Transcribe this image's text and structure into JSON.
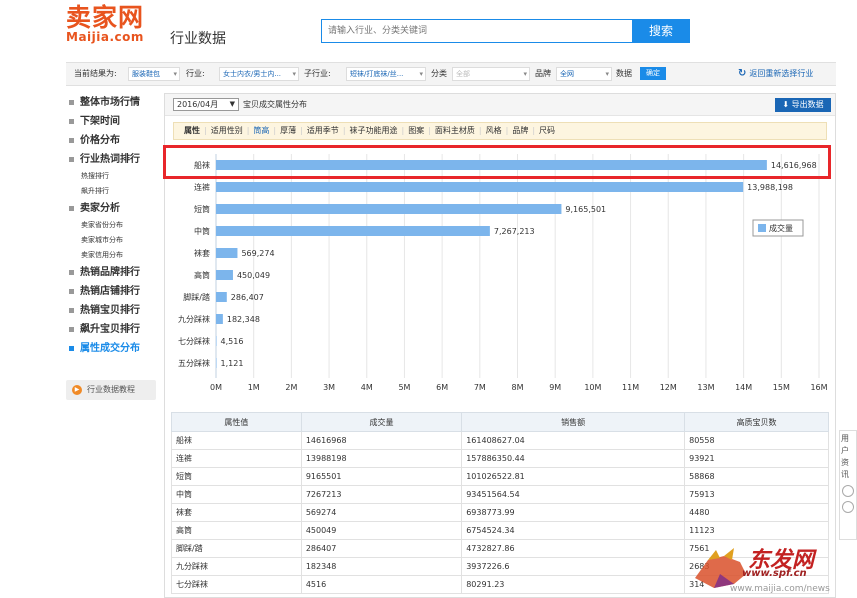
{
  "header": {
    "logo_cn": "卖家网",
    "logo_en": "Maijia.com",
    "logo_sub": "行业数据",
    "search_placeholder": "请输入行业、分类关键词",
    "search_button": "搜索"
  },
  "filters": {
    "current_label": "当前结果为:",
    "category_value": "服装鞋包",
    "industry_label": "行业:",
    "industry_value": "女士内衣/男士内...",
    "subindustry_label": "子行业:",
    "subindustry_value": "短袜/打底袜/丝...",
    "class_label": "分类",
    "class_value": "全部",
    "brand_label": "品牌",
    "brand_value": "全网",
    "data_label": "数据",
    "confirm": "确定",
    "back_label": "返回重新选择行业"
  },
  "sidebar": {
    "items": [
      {
        "label": "整体市场行情",
        "type": "main"
      },
      {
        "label": "下架时间",
        "type": "main"
      },
      {
        "label": "价格分布",
        "type": "main"
      },
      {
        "label": "行业热词排行",
        "type": "main"
      },
      {
        "label": "热搜排行",
        "type": "sub"
      },
      {
        "label": "飙升排行",
        "type": "sub"
      },
      {
        "label": "卖家分析",
        "type": "main"
      },
      {
        "label": "卖家省份分布",
        "type": "sub"
      },
      {
        "label": "卖家城市分布",
        "type": "sub"
      },
      {
        "label": "卖家信用分布",
        "type": "sub"
      },
      {
        "label": "热销品牌排行",
        "type": "main"
      },
      {
        "label": "热销店铺排行",
        "type": "main"
      },
      {
        "label": "热销宝贝排行",
        "type": "main"
      },
      {
        "label": "飙升宝贝排行",
        "type": "main"
      },
      {
        "label": "属性成交分布",
        "type": "main",
        "active": true
      }
    ],
    "tutorial": "行业数据教程"
  },
  "main": {
    "date_value": "2016/04月",
    "title": "宝贝成交属性分布",
    "export_label": "导出数据",
    "attr_tabs": [
      "属性",
      "适用性别",
      "筒高",
      "厚薄",
      "适用季节",
      "袜子功能用途",
      "图案",
      "面料主材质",
      "风格",
      "品牌",
      "尺码"
    ],
    "attr_active_index": 2
  },
  "chart_data": {
    "type": "bar",
    "orientation": "horizontal",
    "categories": [
      "船袜",
      "连裤",
      "短筒",
      "中筒",
      "袜套",
      "高筒",
      "脚踩/踏",
      "九分踩袜",
      "七分踩袜",
      "五分踩袜"
    ],
    "values": [
      14616968,
      13988198,
      9165501,
      7267213,
      569274,
      450049,
      286407,
      182348,
      4516,
      1121
    ],
    "value_labels": [
      "14,616,968",
      "13,988,198",
      "9,165,501",
      "7,267,213",
      "569,274",
      "450,049",
      "286,407",
      "182,348",
      "4,516",
      "1,121"
    ],
    "x_ticks": [
      "0M",
      "1M",
      "2M",
      "3M",
      "4M",
      "5M",
      "6M",
      "7M",
      "8M",
      "9M",
      "10M",
      "11M",
      "12M",
      "13M",
      "14M",
      "15M",
      "16M"
    ],
    "xlim": [
      0,
      16000000
    ],
    "legend": "成交量",
    "legend_position": "right",
    "bar_color": "#7cb5ec"
  },
  "table": {
    "headers": [
      "属性值",
      "成交量",
      "销售额",
      "高质宝贝数"
    ],
    "rows": [
      [
        "船袜",
        "14616968",
        "161408627.04",
        "80558"
      ],
      [
        "连裤",
        "13988198",
        "157886350.44",
        "93921"
      ],
      [
        "短筒",
        "9165501",
        "101026522.81",
        "58868"
      ],
      [
        "中筒",
        "7267213",
        "93451564.54",
        "75913"
      ],
      [
        "袜套",
        "569274",
        "6938773.99",
        "4480"
      ],
      [
        "高筒",
        "450049",
        "6754524.34",
        "11123"
      ],
      [
        "脚踩/踏",
        "286407",
        "4732827.86",
        "7561"
      ],
      [
        "九分踩袜",
        "182348",
        "3937226.6",
        "2683"
      ],
      [
        "七分踩袜",
        "4516",
        "80291.23",
        "314"
      ]
    ]
  },
  "right_float": "用户资讯",
  "watermark": {
    "logo": "东发网",
    "url": "www.spf.cn",
    "url2": "www.maijia.com/news"
  }
}
